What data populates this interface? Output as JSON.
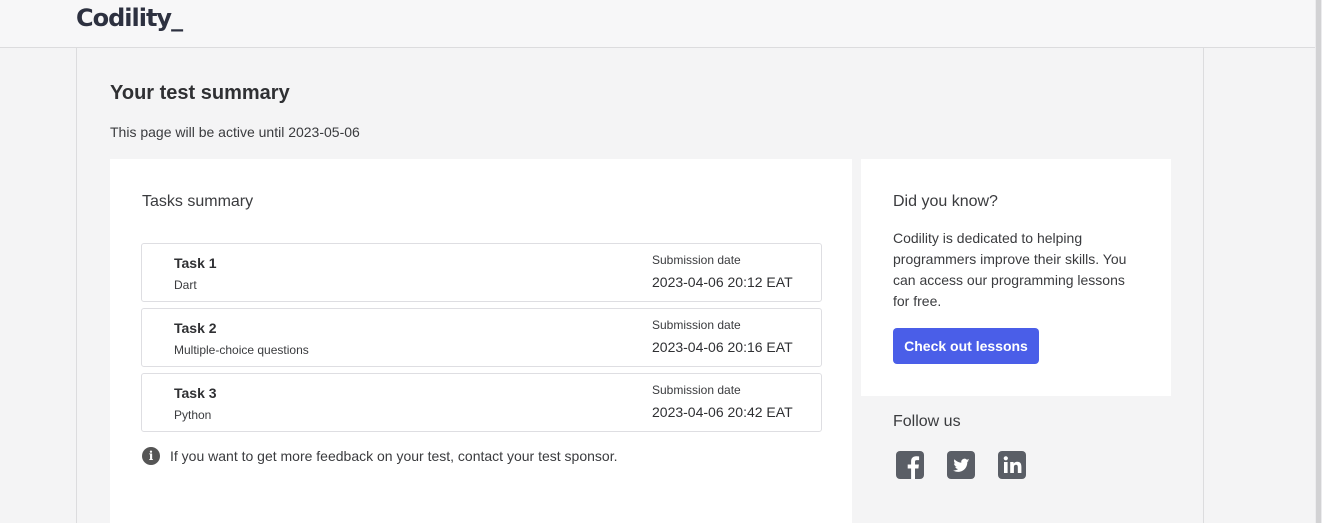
{
  "header": {
    "logo": "Codility_"
  },
  "page": {
    "title": "Your test summary",
    "active_until": "This page will be active until 2023-05-06"
  },
  "tasks": {
    "title": "Tasks summary",
    "items": [
      {
        "name": "Task 1",
        "language": "Dart",
        "submission_label": "Submission date",
        "submission_date": "2023-04-06 20:12 EAT"
      },
      {
        "name": "Task 2",
        "language": "Multiple-choice questions",
        "submission_label": "Submission date",
        "submission_date": "2023-04-06 20:16 EAT"
      },
      {
        "name": "Task 3",
        "language": "Python",
        "submission_label": "Submission date",
        "submission_date": "2023-04-06 20:42 EAT"
      }
    ],
    "feedback": "If you want to get more feedback on your test, contact your test sponsor.",
    "feedback_icon": "info-icon"
  },
  "tip": {
    "title": "Did you know?",
    "body": "Codility is dedicated to helping programmers improve their skills. You can access our programming lessons for free.",
    "button_label": "Check out lessons"
  },
  "social": {
    "title": "Follow us",
    "icons": [
      "facebook-icon",
      "twitter-icon",
      "linkedin-icon"
    ]
  },
  "colors": {
    "accent": "#4a5ee8",
    "background": "#f4f4f5",
    "card": "#ffffff",
    "icon": "#5a5e66"
  }
}
